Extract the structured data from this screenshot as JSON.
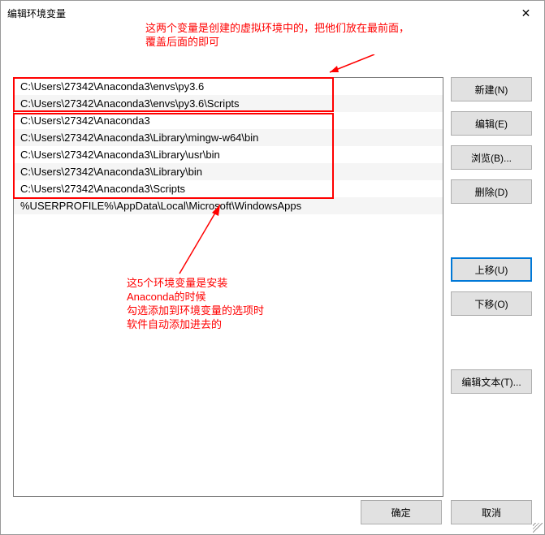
{
  "titlebar": {
    "title": "编辑环境变量"
  },
  "annotations": {
    "top": "这两个变量是创建的虚拟环境中的，把他们放在最前面，\n覆盖后面的即可",
    "middle": "这5个环境变量是安装\nAnaconda的时候\n勾选添加到环境变量的选项时\n软件自动添加进去的"
  },
  "list": {
    "items": [
      "C:\\Users\\27342\\Anaconda3\\envs\\py3.6",
      "C:\\Users\\27342\\Anaconda3\\envs\\py3.6\\Scripts",
      "C:\\Users\\27342\\Anaconda3",
      "C:\\Users\\27342\\Anaconda3\\Library\\mingw-w64\\bin",
      "C:\\Users\\27342\\Anaconda3\\Library\\usr\\bin",
      "C:\\Users\\27342\\Anaconda3\\Library\\bin",
      "C:\\Users\\27342\\Anaconda3\\Scripts",
      "%USERPROFILE%\\AppData\\Local\\Microsoft\\WindowsApps"
    ]
  },
  "buttons": {
    "new": "新建(N)",
    "edit": "编辑(E)",
    "browse": "浏览(B)...",
    "delete": "删除(D)",
    "moveup": "上移(U)",
    "movedown": "下移(O)",
    "edittext": "编辑文本(T)...",
    "ok": "确定",
    "cancel": "取消"
  }
}
